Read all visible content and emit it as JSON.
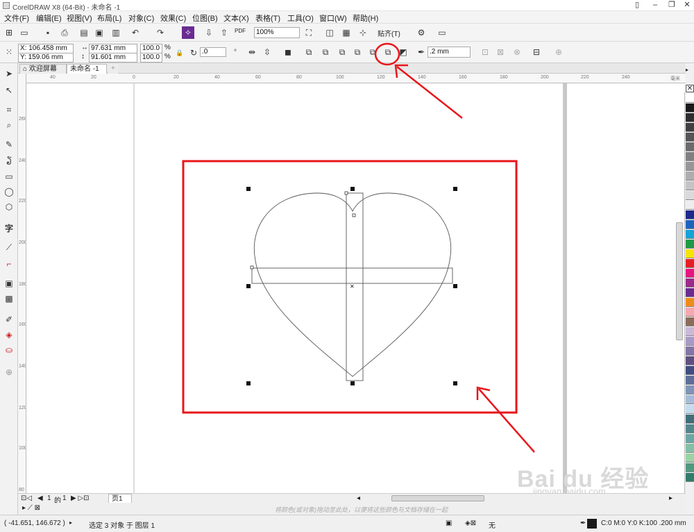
{
  "app": {
    "title": "CorelDRAW X8 (64-Bit) - 未命名 -1"
  },
  "menu": {
    "items": [
      "文件(F)",
      "编辑(E)",
      "视图(V)",
      "布局(L)",
      "对象(C)",
      "效果(C)",
      "位图(B)",
      "文本(X)",
      "表格(T)",
      "工具(O)",
      "窗口(W)",
      "帮助(H)"
    ]
  },
  "toolbar": {
    "zoom": "100%",
    "snap_label": "贴齐(T)",
    "pdf_label": "PDF"
  },
  "props": {
    "x": "X: 106.458 mm",
    "y": "Y: 159.06 mm",
    "w": "97.631 mm",
    "h": "91.601 mm",
    "sx": "100.0",
    "sy": "100.0",
    "pct": "%",
    "rot": ".0",
    "outline": ".2 mm"
  },
  "tabs": {
    "welcome": "欢迎屏幕",
    "doc": "未命名 -1"
  },
  "ruler": {
    "h": [
      "40",
      "20",
      "0",
      "20",
      "40",
      "60",
      "80",
      "100",
      "120",
      "140",
      "160",
      "180",
      "200",
      "220",
      "240"
    ],
    "hunit": "毫米",
    "v": [
      "260",
      "240",
      "220",
      "200",
      "180",
      "160",
      "140",
      "120",
      "100",
      "80"
    ]
  },
  "pages": {
    "current": "1",
    "of": "的",
    "total": "1",
    "tab": "页1"
  },
  "hint": "将颜色(或对象)拖动至此处，以便将这些颜色与文档存储在一起",
  "status": {
    "coords": "( -41.651, 146.672 )",
    "selection": "选定 3 对象 于 图层 1",
    "fill": "无",
    "outline_info": "C:0 M:0 Y:0 K:100  .200 mm"
  },
  "watermark": {
    "brand": "Bai du 经验",
    "url": "jingyan.baidu.com"
  },
  "colors": {
    "accent": "#e8161b",
    "palette": [
      "#ffffff",
      "#1a1a1a",
      "#2d2d2d",
      "#404040",
      "#555555",
      "#6b6b6b",
      "#808080",
      "#969696",
      "#adadad",
      "#c4c4c4",
      "#dadada",
      "#ededed",
      "#1d2a8c",
      "#1a64c0",
      "#17a2d8",
      "#1e9a46",
      "#f5e400",
      "#e61e24",
      "#e6167f",
      "#9b2a8c",
      "#6a2c91",
      "#f08c18",
      "#f5a8b0",
      "#8b6c5a",
      "#c9b8d8",
      "#a89ac6",
      "#8474a8",
      "#5e4f80",
      "#3f4d80",
      "#5d6f98",
      "#7f95b8",
      "#a4bcd8",
      "#c4dcf0",
      "#3f6e7a",
      "#52878d",
      "#6aa7a4",
      "#82bfa6",
      "#9ad2a6",
      "#4f9a7e",
      "#2f7d6a"
    ]
  }
}
